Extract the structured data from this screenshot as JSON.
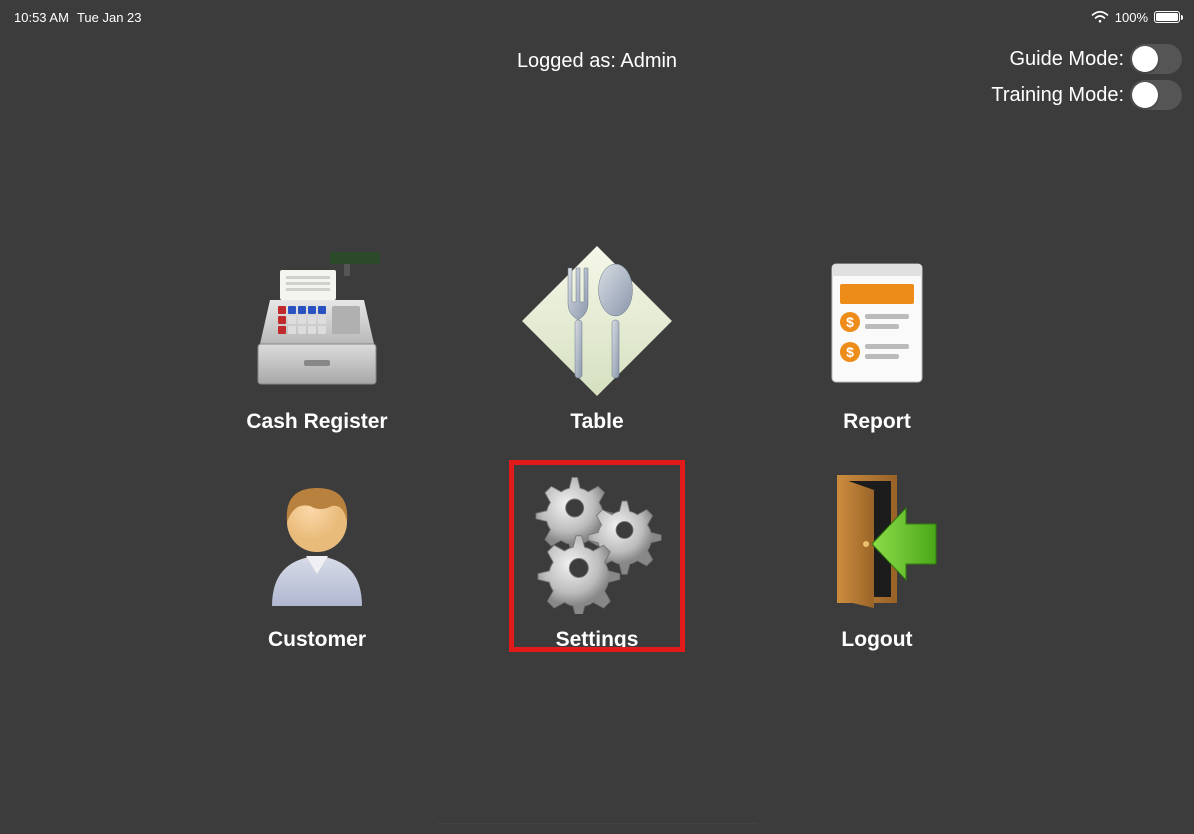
{
  "status": {
    "time": "10:53 AM",
    "date": "Tue Jan 23",
    "battery_percent": "100%"
  },
  "header": {
    "logged_as": "Logged as: Admin",
    "toggles": {
      "guide_label": "Guide Mode:",
      "training_label": "Training Mode:"
    }
  },
  "menu": {
    "cash_register": "Cash Register",
    "table": "Table",
    "report": "Report",
    "customer": "Customer",
    "settings": "Settings",
    "logout": "Logout"
  }
}
